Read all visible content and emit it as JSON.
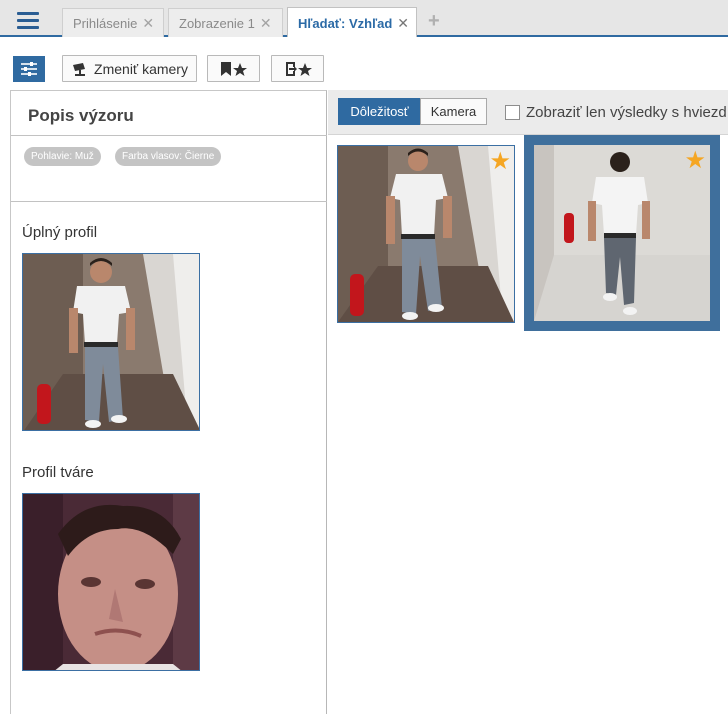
{
  "tabs": [
    {
      "label": "Prihlásenie",
      "active": false
    },
    {
      "label": "Zobrazenie 1",
      "active": false
    },
    {
      "label": "Hľadať: Vzhľad",
      "active": true
    }
  ],
  "toolbar": {
    "change_cameras_label": "Zmeniť kamery"
  },
  "left_panel": {
    "title": "Popis výzoru",
    "chips": [
      "Pohlavie: Muž",
      "Farba vlasov: Čierne"
    ],
    "full_profile_label": "Úplný profil",
    "face_profile_label": "Profil tváre"
  },
  "results": {
    "sort_buttons": [
      "Dôležitosť",
      "Kamera"
    ],
    "starred_only_label": "Zobraziť len výsledky s hviezd",
    "items": [
      {
        "starred": true,
        "selected": false
      },
      {
        "starred": true,
        "selected": true
      }
    ]
  },
  "colors": {
    "accent": "#2f6aa1",
    "star": "#f5a623",
    "chip": "#c4c4c4"
  },
  "icons": {
    "menu": "hamburger-icon",
    "filter": "sliders-icon",
    "camera": "camera-icon",
    "bookmark_star": "bookmark-star-icon",
    "export_star": "export-star-icon",
    "close": "close-icon",
    "add": "plus-icon",
    "star": "star-icon"
  }
}
